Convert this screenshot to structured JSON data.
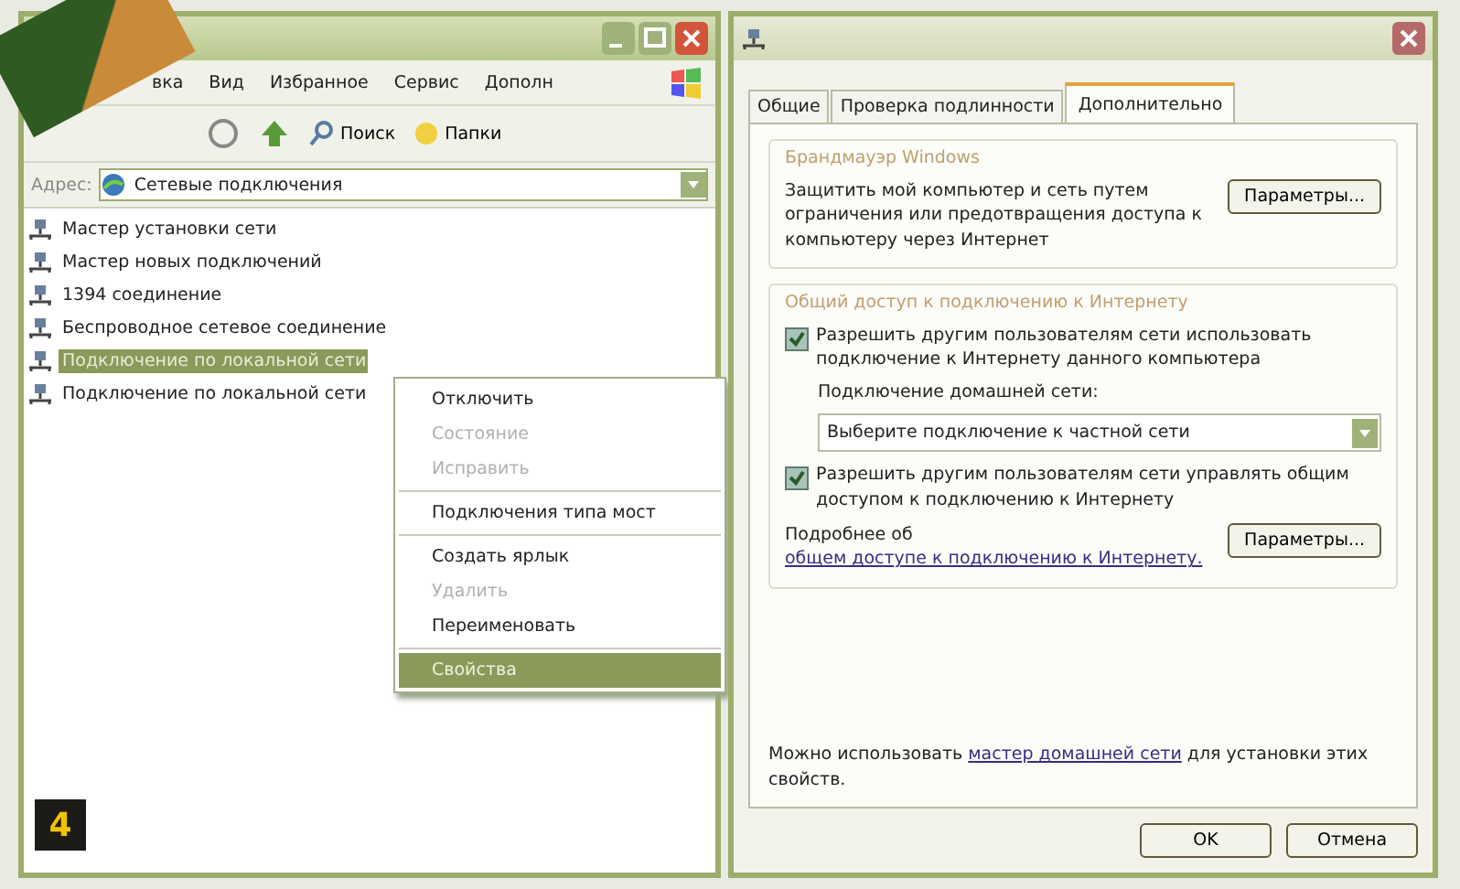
{
  "explorer": {
    "menu": [
      "вка",
      "Вид",
      "Избранное",
      "Сервис",
      "Дополн"
    ],
    "toolbar": [
      {
        "label": "Поиск",
        "kind": "search"
      },
      {
        "label": "Папки",
        "kind": "folders"
      }
    ],
    "address": {
      "label": "Адрес:",
      "value": "Сетевые подключения"
    },
    "items": [
      {
        "label": "Мастер установки сети",
        "selected": false
      },
      {
        "label": "Мастер новых подключений",
        "selected": false
      },
      {
        "label": "1394 соединение",
        "selected": false
      },
      {
        "label": "Беспроводное сетевое соединение",
        "selected": false
      },
      {
        "label": "Подключение по локальной сети",
        "selected": true
      },
      {
        "label": "Подключение по локальной сети",
        "selected": false
      }
    ],
    "context_menu": [
      {
        "kind": "item",
        "label": "Отключить",
        "disabled": false,
        "selected": false
      },
      {
        "kind": "item",
        "label": "Состояние",
        "disabled": true,
        "selected": false
      },
      {
        "kind": "item",
        "label": "Исправить",
        "disabled": true,
        "selected": false
      },
      {
        "kind": "separator"
      },
      {
        "kind": "item",
        "label": "Подключения типа мост",
        "disabled": false,
        "selected": false
      },
      {
        "kind": "separator"
      },
      {
        "kind": "item",
        "label": "Создать ярлык",
        "disabled": false,
        "selected": false
      },
      {
        "kind": "item",
        "label": "Удалить",
        "disabled": true,
        "selected": false
      },
      {
        "kind": "item",
        "label": "Переименовать",
        "disabled": false,
        "selected": false
      },
      {
        "kind": "separator"
      },
      {
        "kind": "item",
        "label": "Свойства",
        "disabled": false,
        "selected": true
      }
    ]
  },
  "dialog": {
    "tabs": [
      {
        "label": "Общие",
        "selected": false
      },
      {
        "label": "Проверка подлинности",
        "selected": false
      },
      {
        "label": "Дополнительно",
        "selected": true
      }
    ],
    "firewall": {
      "title": "Брандмауэр Windows",
      "text": "Защитить мой компьютер и сеть путем ограничения или предотвращения доступа к компьютеру через Интернет",
      "button": "Параметры..."
    },
    "sharing": {
      "title": "Общий доступ к подключению к Интернету",
      "checkboxes": [
        {
          "label": "Разрешить другим пользователям сети использовать подключение к Интернету данного компьютера",
          "checked": true
        },
        {
          "label": "Разрешить другим пользователям сети управлять общим доступом к подключению к Интернету",
          "checked": true
        }
      ],
      "home_label": "Подключение домашней сети:",
      "home_value": "Выберите подключение к частной сети",
      "more_text": "Подробнее об",
      "more_link": "общем доступе к подключению к Интернету.",
      "button": "Параметры..."
    },
    "wizard": {
      "before": "Можно использовать",
      "link": "мастер домашней сети",
      "after": "для установки этих свойств."
    },
    "buttons": [
      "OK",
      "Отмена"
    ]
  },
  "figure_number": "4"
}
